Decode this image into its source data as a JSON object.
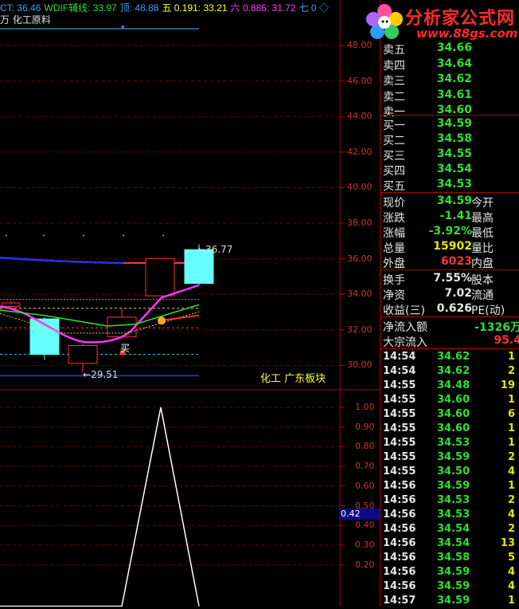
{
  "indicator_line": {
    "items": [
      {
        "text": "CT: 36.46",
        "color": "#3aa0ff"
      },
      {
        "text": "WDIF辅线: 33.97",
        "color": "#33dd33"
      },
      {
        "text": "顶: 48.88",
        "color": "#3aa0ff"
      },
      {
        "text": "五 0.191: 33.21",
        "color": "#ffff33"
      },
      {
        "text": "六 0.886: 31.72",
        "color": "#ff3aff"
      },
      {
        "text": "七 0 ◇",
        "color": "#3aa0ff"
      }
    ]
  },
  "stock_name": "万 化工原料",
  "logo": {
    "title": "分析家公式网",
    "url": "www.88gs.com"
  },
  "price_axis": [
    "48.00",
    "46.00",
    "44.00",
    "42.00",
    "40.00",
    "38.00",
    "36.00",
    "34.00",
    "32.00",
    "30.00"
  ],
  "indicator_axis": [
    "1.00",
    "0.90",
    "0.80",
    "0.70",
    "0.60",
    "0.50",
    "0.40",
    "0.30",
    "0.20"
  ],
  "current_indicator_value": "0.42",
  "sector_label": "化工 广东板块",
  "low_label": "←29.51",
  "high_label": "←36.77",
  "buy_marker": "买",
  "order_book": {
    "asks": [
      {
        "label": "卖五",
        "price": "34.66"
      },
      {
        "label": "卖四",
        "price": "34.64"
      },
      {
        "label": "卖三",
        "price": "34.62"
      },
      {
        "label": "卖二",
        "price": "34.61"
      },
      {
        "label": "卖一",
        "price": "34.60"
      }
    ],
    "bids": [
      {
        "label": "买一",
        "price": "34.59"
      },
      {
        "label": "买二",
        "price": "34.58"
      },
      {
        "label": "买三",
        "price": "34.55"
      },
      {
        "label": "买四",
        "price": "34.54"
      },
      {
        "label": "买五",
        "price": "34.53"
      }
    ]
  },
  "stats": [
    {
      "label": "现价",
      "value": "34.59",
      "color": "#33dd33",
      "label2": "今开"
    },
    {
      "label": "涨跌",
      "value": "-1.41",
      "color": "#33dd33",
      "label2": "最高"
    },
    {
      "label": "涨幅",
      "value": "-3.92%",
      "color": "#33dd33",
      "label2": "最低"
    },
    {
      "label": "总量",
      "value": "15902",
      "color": "#e6e600",
      "label2": "量比"
    },
    {
      "label": "外盘",
      "value": "6023",
      "color": "#ff3333",
      "label2": "内盘"
    }
  ],
  "stats2": [
    {
      "label": "换手",
      "value": "7.55%",
      "color": "#e6e6e6",
      "label2": "股本"
    },
    {
      "label": "净资",
      "value": "7.02",
      "color": "#e6e6e6",
      "label2": "流通"
    },
    {
      "label": "收益(三)",
      "value": "0.626",
      "color": "#e6e6e6",
      "label2": "PE(动)"
    }
  ],
  "flow": [
    {
      "label": "净流入额",
      "value": "-1326万",
      "color": "#33dd33"
    },
    {
      "label": "大宗流入",
      "value": "95.4",
      "color": "#ff3333"
    }
  ],
  "ticks": [
    {
      "time": "14:54",
      "price": "34.62",
      "vol": "1"
    },
    {
      "time": "14:54",
      "price": "34.62",
      "vol": "2"
    },
    {
      "time": "14:55",
      "price": "34.48",
      "vol": "19"
    },
    {
      "time": "14:55",
      "price": "34.60",
      "vol": "1"
    },
    {
      "time": "14:55",
      "price": "34.60",
      "vol": "6"
    },
    {
      "time": "14:55",
      "price": "34.60",
      "vol": "1"
    },
    {
      "time": "14:55",
      "price": "34.53",
      "vol": "1"
    },
    {
      "time": "14:55",
      "price": "34.59",
      "vol": "2"
    },
    {
      "time": "14:55",
      "price": "34.50",
      "vol": "4"
    },
    {
      "time": "14:56",
      "price": "34.59",
      "vol": "1"
    },
    {
      "time": "14:56",
      "price": "34.53",
      "vol": "2"
    },
    {
      "time": "14:56",
      "price": "34.53",
      "vol": "4"
    },
    {
      "time": "14:56",
      "price": "34.54",
      "vol": "2"
    },
    {
      "time": "14:56",
      "price": "34.54",
      "vol": "13"
    },
    {
      "time": "14:56",
      "price": "34.58",
      "vol": "5"
    },
    {
      "time": "14:56",
      "price": "34.59",
      "vol": "4"
    },
    {
      "time": "14:56",
      "price": "34.59",
      "vol": "4"
    },
    {
      "time": "14:57",
      "price": "34.59",
      "vol": "1"
    }
  ],
  "colors": {
    "up": "#ff3333",
    "down": "#33dd33",
    "grid": "#b00000",
    "volume": "#e6e600"
  }
}
